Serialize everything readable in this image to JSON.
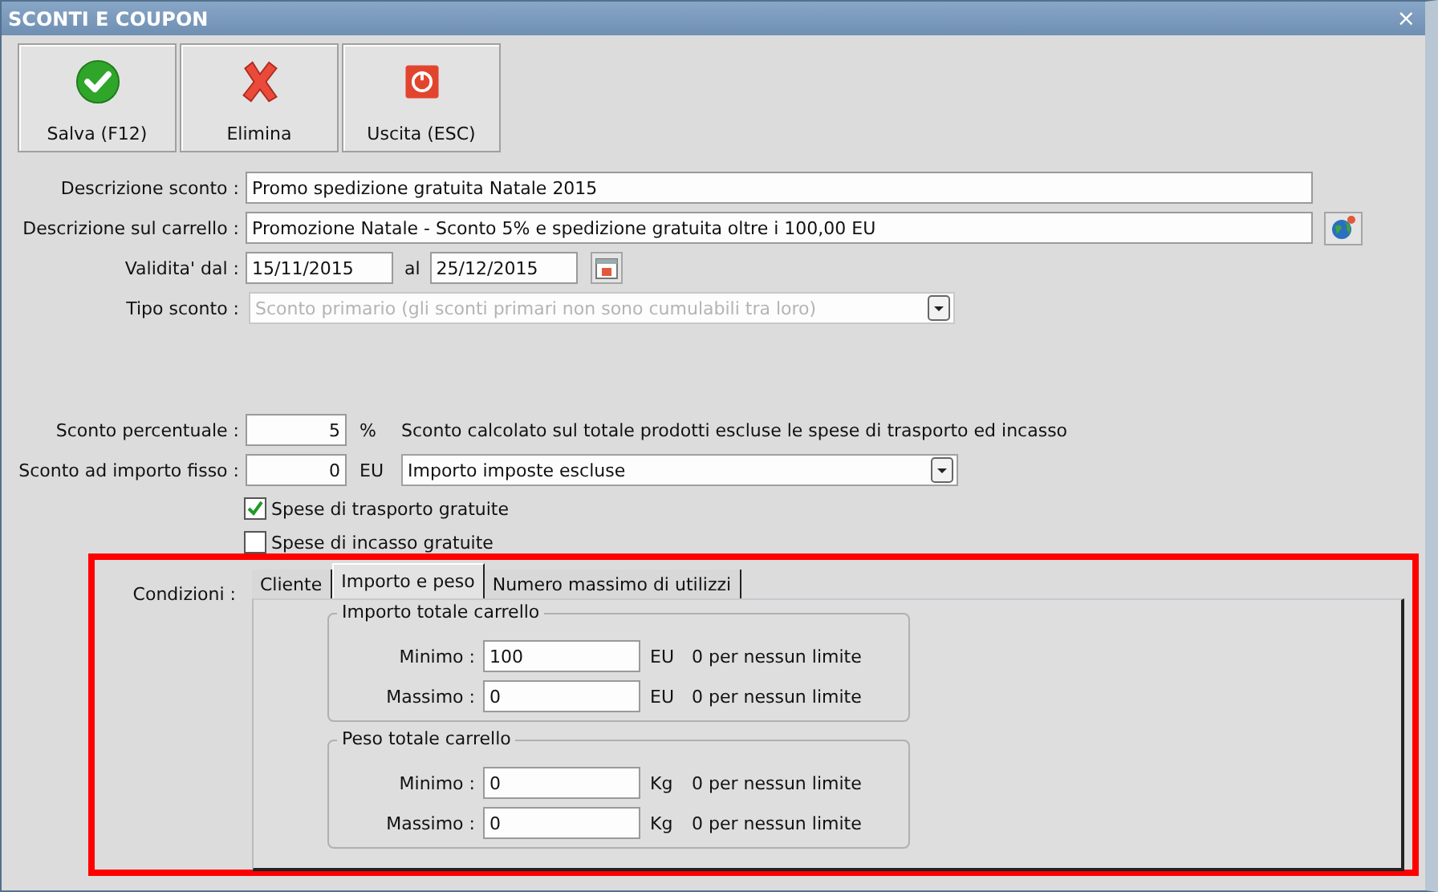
{
  "window": {
    "title": "SCONTI E COUPON",
    "close": "×"
  },
  "toolbar": [
    {
      "label": "Salva (F12)",
      "kind": "save"
    },
    {
      "label": "Elimina",
      "kind": "delete"
    },
    {
      "label": "Uscita (ESC)",
      "kind": "exit"
    }
  ],
  "description": {
    "label": "Descrizione sconto :",
    "value": "Promo spedizione gratuita Natale 2015"
  },
  "cart_description": {
    "label": "Descrizione sul carrello :",
    "value": "Promozione Natale - Sconto 5% e spedizione gratuita oltre i 100,00 EU"
  },
  "validity": {
    "label": "Validita' dal :",
    "from": "15/11/2015",
    "to_label": "al",
    "to": "25/12/2015"
  },
  "discount_type": {
    "label": "Tipo sconto :",
    "value": "Sconto primario (gli sconti primari non sono cumulabili tra loro)",
    "disabled": true
  },
  "percent": {
    "label": "Sconto percentuale :",
    "value": "5",
    "unit": "%",
    "note": "Sconto calcolato sul totale prodotti escluse le spese di trasporto ed incasso"
  },
  "fixed": {
    "label": "Sconto ad importo fisso :",
    "value": "0",
    "unit": "EU",
    "dropdown": "Importo imposte escluse"
  },
  "checkboxes": [
    {
      "label": "Spese di trasporto gratuite",
      "checked": true
    },
    {
      "label": "Spese di incasso gratuite",
      "checked": false
    }
  ],
  "conditions": {
    "label": "Condizioni :",
    "tabs": [
      {
        "label": "Cliente",
        "selected": false
      },
      {
        "label": "Importo e peso",
        "selected": true
      },
      {
        "label": "Numero massimo di utilizzi",
        "selected": false
      }
    ],
    "groups": [
      {
        "title": "Importo totale carrello",
        "rows": [
          {
            "label": "Minimo :",
            "value": "100",
            "unit": "EU",
            "hint": "0 per nessun limite"
          },
          {
            "label": "Massimo :",
            "value": "0",
            "unit": "EU",
            "hint": "0 per nessun limite"
          }
        ]
      },
      {
        "title": "Peso totale carrello",
        "rows": [
          {
            "label": "Minimo :",
            "value": "0",
            "unit": "Kg",
            "hint": "0 per nessun limite"
          },
          {
            "label": "Massimo :",
            "value": "0",
            "unit": "Kg",
            "hint": "0 per nessun limite"
          }
        ]
      }
    ]
  }
}
